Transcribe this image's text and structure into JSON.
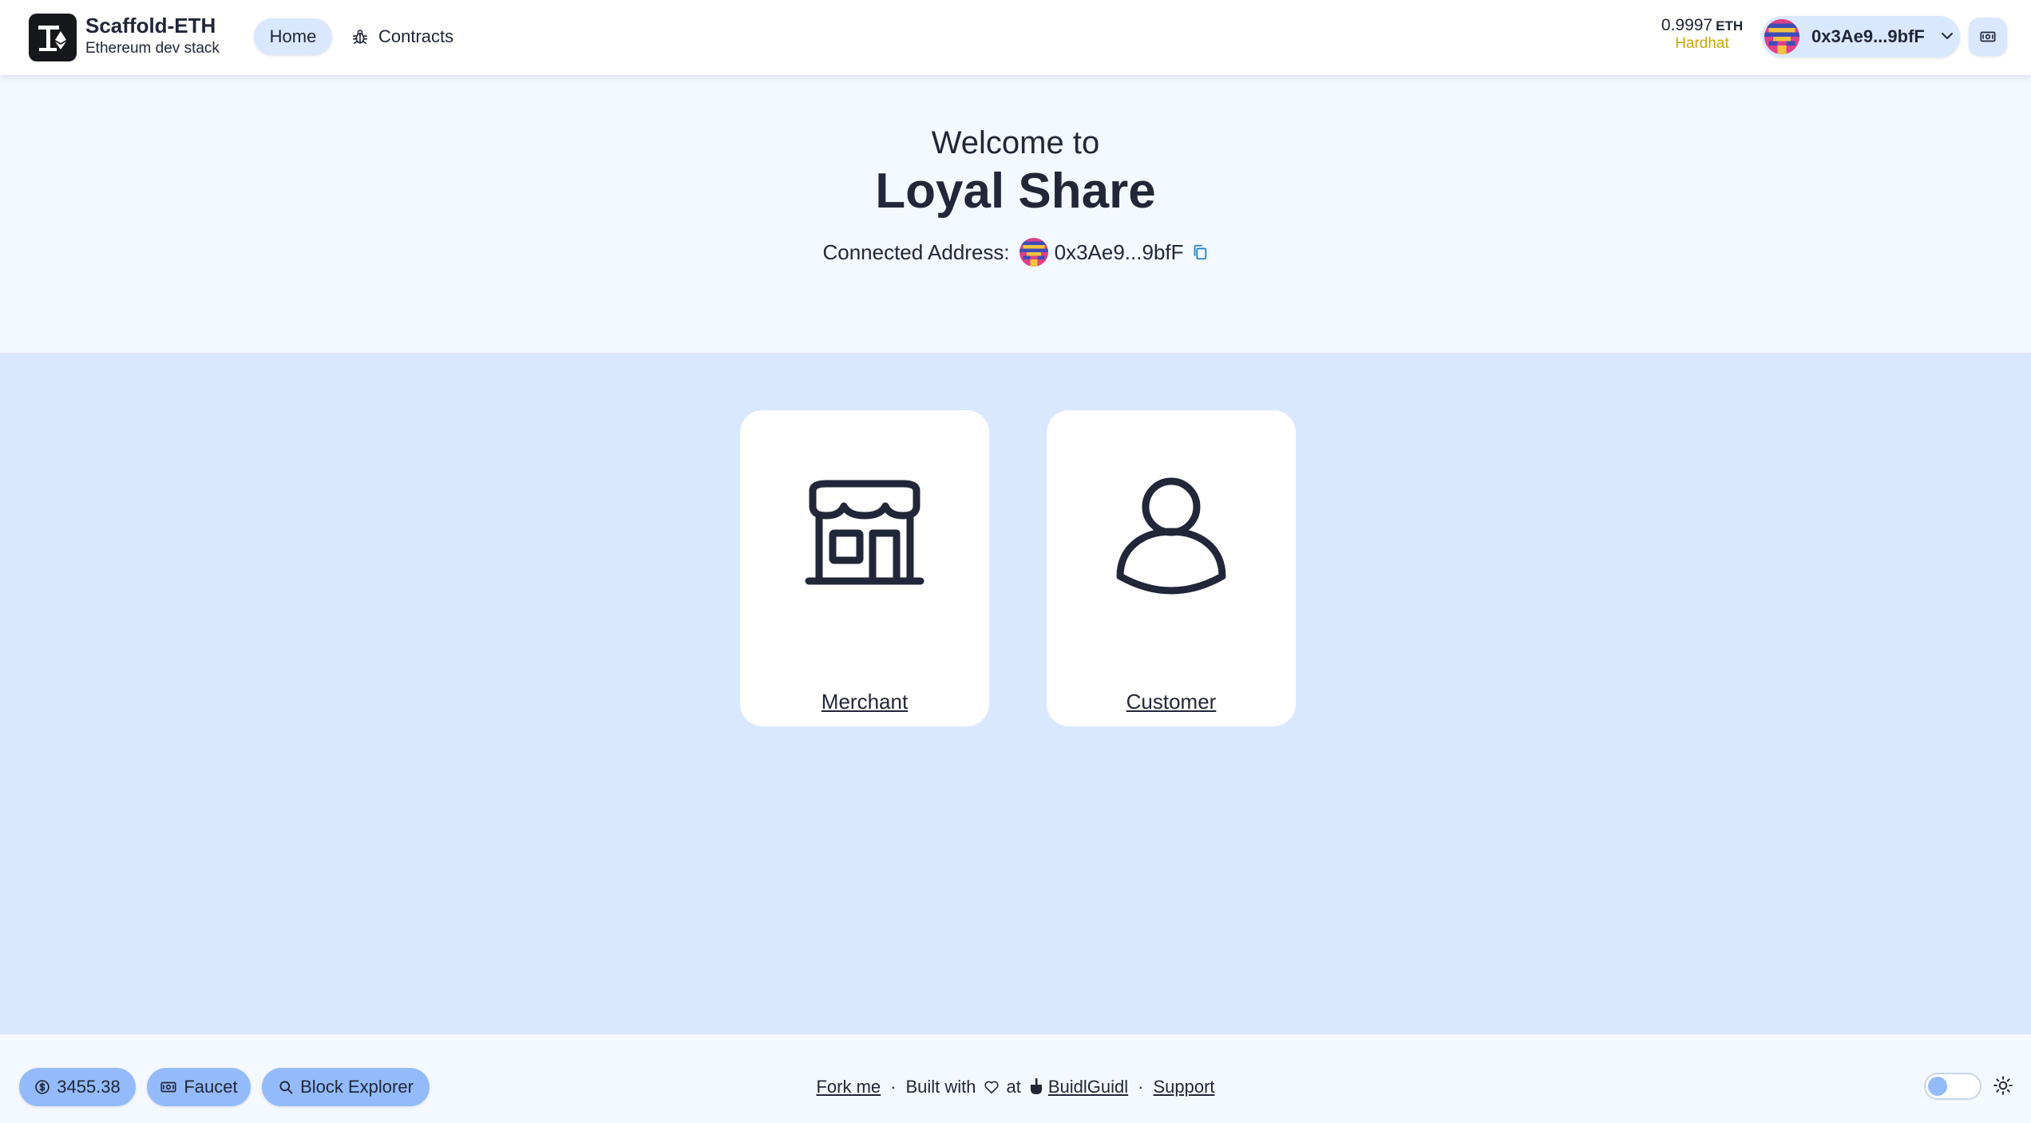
{
  "header": {
    "brand_title": "Scaffold-ETH",
    "brand_subtitle": "Ethereum dev stack",
    "nav": {
      "home": "Home",
      "contracts": "Contracts"
    },
    "balance": {
      "amount": "0.9997",
      "unit": "ETH",
      "network": "Hardhat"
    },
    "account": {
      "address": "0x3Ae9...9bfF"
    },
    "icons": [
      "scaffold-logo-icon",
      "bug-icon",
      "chevron-down-icon",
      "qr-code-icon"
    ]
  },
  "hero": {
    "welcome": "Welcome to",
    "title": "Loyal Share",
    "connected_label": "Connected Address:",
    "connected_address": "0x3Ae9...9bfF"
  },
  "cards": [
    {
      "label": "Merchant",
      "icon": "storefront-icon"
    },
    {
      "label": "Customer",
      "icon": "user-icon"
    }
  ],
  "footer": {
    "price": "3455.38",
    "faucet": "Faucet",
    "block_explorer": "Block Explorer",
    "fork_me": "Fork me",
    "built_with": "Built with",
    "at": "at",
    "buidlguidl": "BuidlGuidl",
    "support": "Support",
    "separator": "·"
  },
  "colors": {
    "primary": "#93bbfb",
    "secondary": "#dae8ff",
    "base_100": "#f4f8ff",
    "text": "#212638",
    "network": "#c9a70b",
    "copy_icon": "#1d87c9"
  }
}
